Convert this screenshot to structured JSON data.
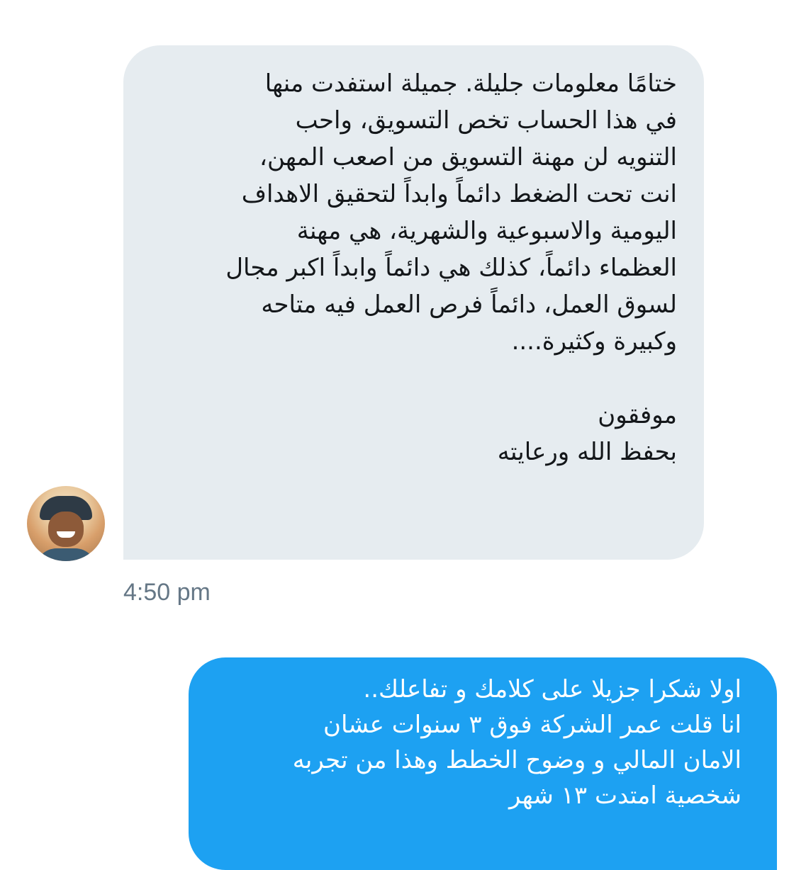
{
  "conversation": {
    "received_message": {
      "text": "ختامًا معلومات جليلة. جميلة استفدت منها\nفي هذا الحساب تخص التسويق، واحب\nالتنويه لن مهنة التسويق من اصعب المهن،\nانت تحت الضغط دائماً وابداً لتحقيق الاهداف\nاليومية والاسبوعية والشهرية، هي مهنة\nالعظماء دائماً، كذلك هي دائماً وابداً اكبر مجال\nلسوق العمل، دائماً فرص العمل فيه متاحه\nوكبيرة وكثيرة....\n\nموفقون\nبحفظ الله ورعايته",
      "time": "4:50 pm",
      "avatar": "sender-avatar"
    },
    "sent_message": {
      "text": "اولا شكرا جزيلا على كلامك و تفاعلك..\nانا قلت عمر الشركة فوق ٣ سنوات عشان\nالامان المالي و وضوح الخطط وهذا من تجربه\nشخصية امتدت ١٣ شهر"
    }
  },
  "colors": {
    "received_bubble": "#e6ecf0",
    "sent_bubble": "#1da1f2",
    "timestamp": "#657786",
    "text_dark": "#14171a",
    "text_light": "#ffffff"
  }
}
